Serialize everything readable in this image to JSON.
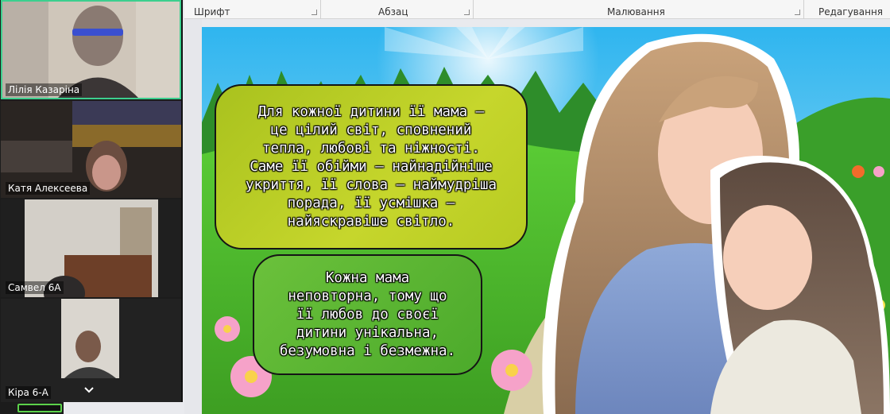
{
  "ribbon": {
    "groups": [
      {
        "label": "Шрифт"
      },
      {
        "label": "Абзац"
      },
      {
        "label": "Малювання"
      },
      {
        "label": "Редагування"
      }
    ]
  },
  "participants": [
    {
      "name": "Лілія Казаріна",
      "active": true
    },
    {
      "name": "Катя Алексеева",
      "active": false
    },
    {
      "name": "Самвел 6А",
      "active": false
    },
    {
      "name": "Кіра 6-А",
      "active": false
    }
  ],
  "slide": {
    "bubble1_lines": [
      "Для кожної дитини її мама —",
      "це цілий світ, сповнений",
      "тепла, любові та ніжності.",
      "Саме її обійми — найнадійніше",
      "укриття, її слова — наймудріша",
      "порада, її усмішка —",
      "найяскравіше світло."
    ],
    "bubble2_lines": [
      "Кожна мама",
      "неповторна, тому що",
      "її любов до своєї",
      "дитини унікальна,",
      "безумовна і безмежна."
    ]
  },
  "colors": {
    "active_border": "#3ccf8e",
    "bubble1": "#b7cb22",
    "bubble2": "#5cb533"
  }
}
